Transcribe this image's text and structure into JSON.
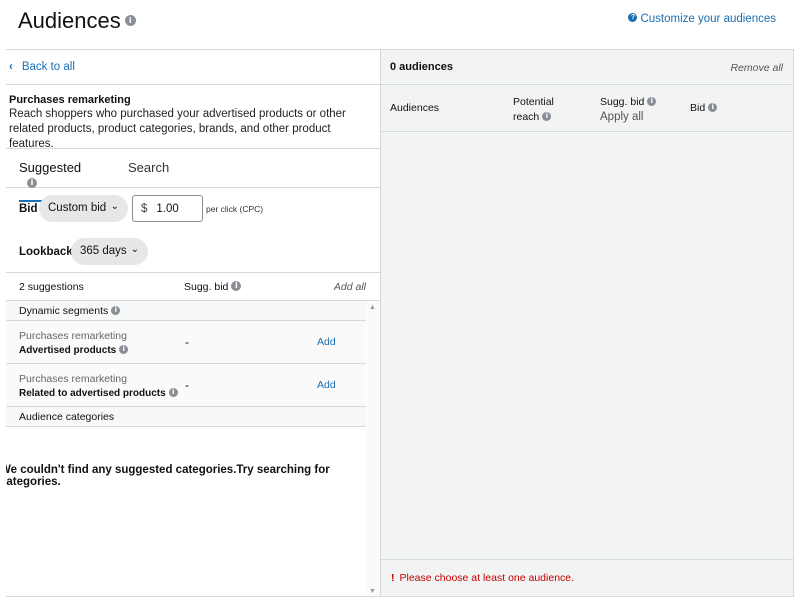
{
  "header": {
    "title": "Audiences",
    "customize_link": "Customize your audiences"
  },
  "left": {
    "back_link": "Back to all",
    "description": {
      "title": "Purchases remarketing",
      "body": "Reach shoppers who purchased your advertised products or other related products, product categories, brands, and other product features."
    },
    "tabs": [
      {
        "label": "Suggested",
        "active": true
      },
      {
        "label": "Search",
        "active": false
      }
    ],
    "bid": {
      "label": "Bid",
      "type_selected": "Custom bid",
      "currency": "$",
      "value": "1.00",
      "unit": "per click (CPC)"
    },
    "lookback": {
      "label": "Lookback",
      "selected": "365 days"
    },
    "suggestions_header": {
      "count": "2 suggestions",
      "sugg_bid": "Sugg. bid",
      "add_all": "Add all"
    },
    "groups": {
      "dynamic_segments": "Dynamic segments",
      "audience_categories": "Audience categories"
    },
    "items": [
      {
        "category": "Purchases remarketing",
        "name": "Advertised products",
        "bid": "-",
        "action": "Add"
      },
      {
        "category": "Purchases remarketing",
        "name": "Related to advertised products",
        "bid": "-",
        "action": "Add"
      }
    ],
    "empty_message": "We couldn't find any suggested categories.Try searching for categories."
  },
  "right": {
    "count": "0 audiences",
    "remove_all": "Remove all",
    "columns": {
      "audiences": "Audiences",
      "potential": "Potential",
      "reach": "reach",
      "sugg_bid": "Sugg. bid",
      "apply_all": "Apply all",
      "bid": "Bid"
    },
    "error": "Please choose at least one audience."
  },
  "colors": {
    "link": "#1a6fb3",
    "error": "#c40000",
    "panel_bg": "#f2f3f3"
  },
  "icons": {
    "info": "info-icon",
    "help": "help-icon",
    "back": "chevron-left-icon",
    "dropdown": "chevron-down-icon",
    "error": "exclamation-icon"
  }
}
